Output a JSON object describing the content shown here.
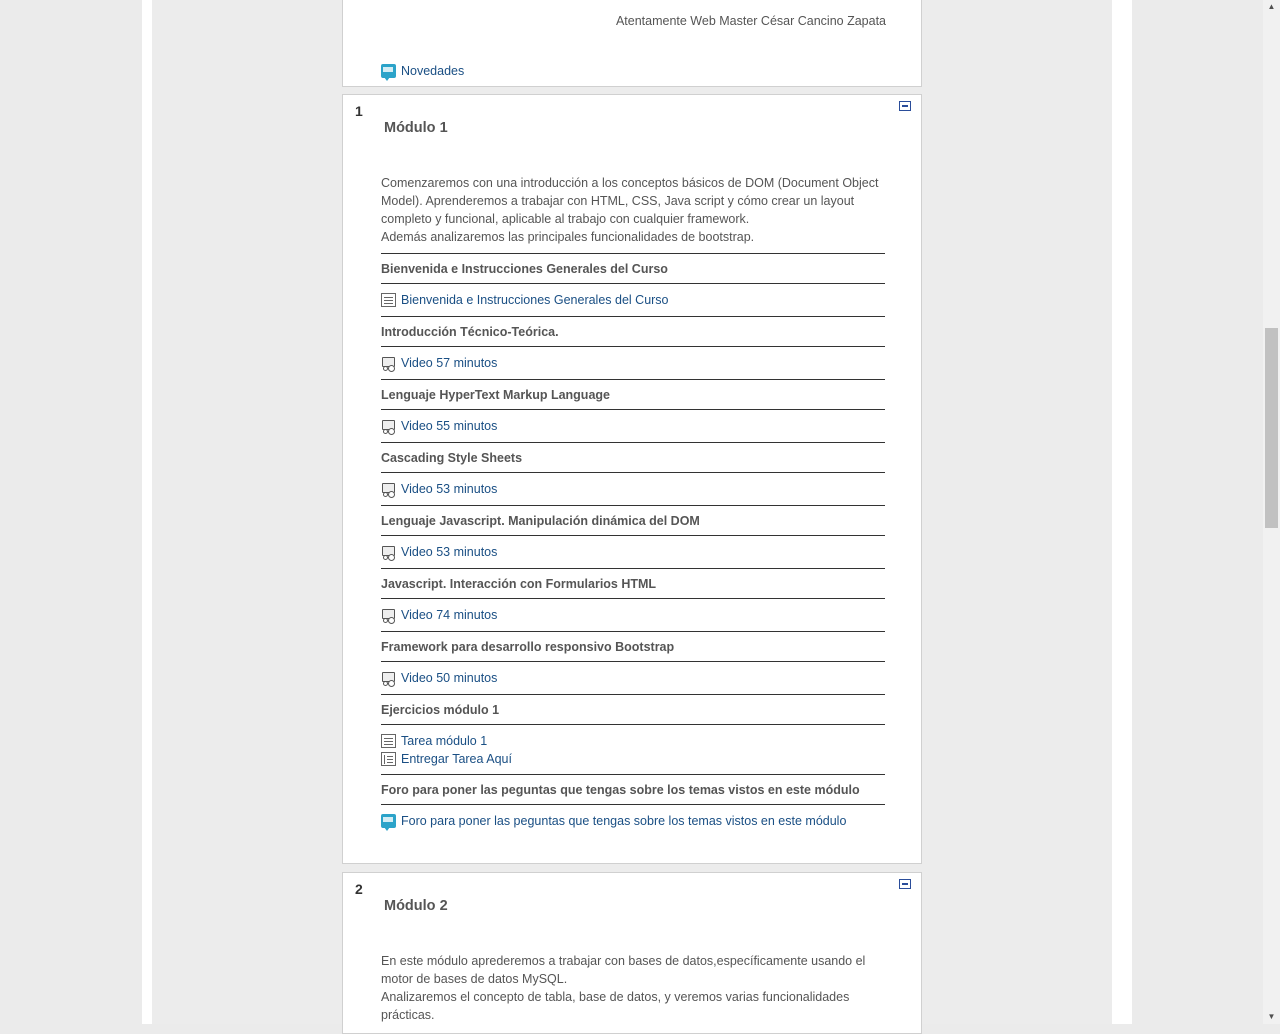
{
  "top_section": {
    "signature": "Atentamente Web Master César Cancino Zapata",
    "news_link": "Novedades"
  },
  "sections": [
    {
      "number": "1",
      "title": "Módulo 1",
      "summary": [
        "Comenzaremos con una introducción a los conceptos básicos de DOM (Document Object Model). Aprenderemos a trabajar con HTML, CSS, Java script y cómo crear un layout completo y funcional, aplicable al trabajo con cualquier framework.",
        "Además analizaremos las principales funcionalidades de bootstrap."
      ],
      "blocks": [
        {
          "label": "Bienvenida e Instrucciones Generales del Curso",
          "items": [
            {
              "icon": "page-icon",
              "text": "Bienvenida e Instrucciones Generales del Curso"
            }
          ]
        },
        {
          "label": "Introducción Técnico-Teórica.",
          "items": [
            {
              "icon": "video-icon",
              "text": "Video 57 minutos"
            }
          ]
        },
        {
          "label": "Lenguaje HyperText Markup Language",
          "items": [
            {
              "icon": "video-icon",
              "text": "Video 55 minutos"
            }
          ]
        },
        {
          "label": "Cascading Style Sheets",
          "items": [
            {
              "icon": "video-icon",
              "text": "Video 53 minutos"
            }
          ]
        },
        {
          "label": "Lenguaje Javascript. Manipulación dinámica del DOM",
          "items": [
            {
              "icon": "video-icon",
              "text": "Video 53 minutos"
            }
          ]
        },
        {
          "label": "Javascript. Interacción con Formularios HTML",
          "items": [
            {
              "icon": "video-icon",
              "text": "Video 74 minutos"
            }
          ]
        },
        {
          "label": "Framework para desarrollo responsivo Bootstrap",
          "items": [
            {
              "icon": "video-icon",
              "text": "Video 50 minutos"
            }
          ]
        },
        {
          "label": "Ejercicios módulo 1",
          "items": [
            {
              "icon": "page-icon",
              "text": "Tarea módulo 1"
            },
            {
              "icon": "assignment-icon",
              "text": "Entregar Tarea Aquí"
            }
          ]
        },
        {
          "label": "Foro para poner las peguntas que tengas sobre los temas vistos en este módulo",
          "items": [
            {
              "icon": "forum-icon",
              "text": "Foro para poner las peguntas que tengas sobre los temas vistos en este módulo"
            }
          ]
        }
      ]
    },
    {
      "number": "2",
      "title": "Módulo 2",
      "summary": [
        "En este módulo aprederemos a trabajar con bases de datos,específicamente usando el motor de bases de datos MySQL.",
        "Analizaremos el concepto de tabla, base de datos, y veremos varias funcionalidades prácticas."
      ]
    }
  ],
  "colors": {
    "link": "#1a4f84",
    "page_bg": "#ececec",
    "collapse_icon": "#2a4d9a"
  }
}
